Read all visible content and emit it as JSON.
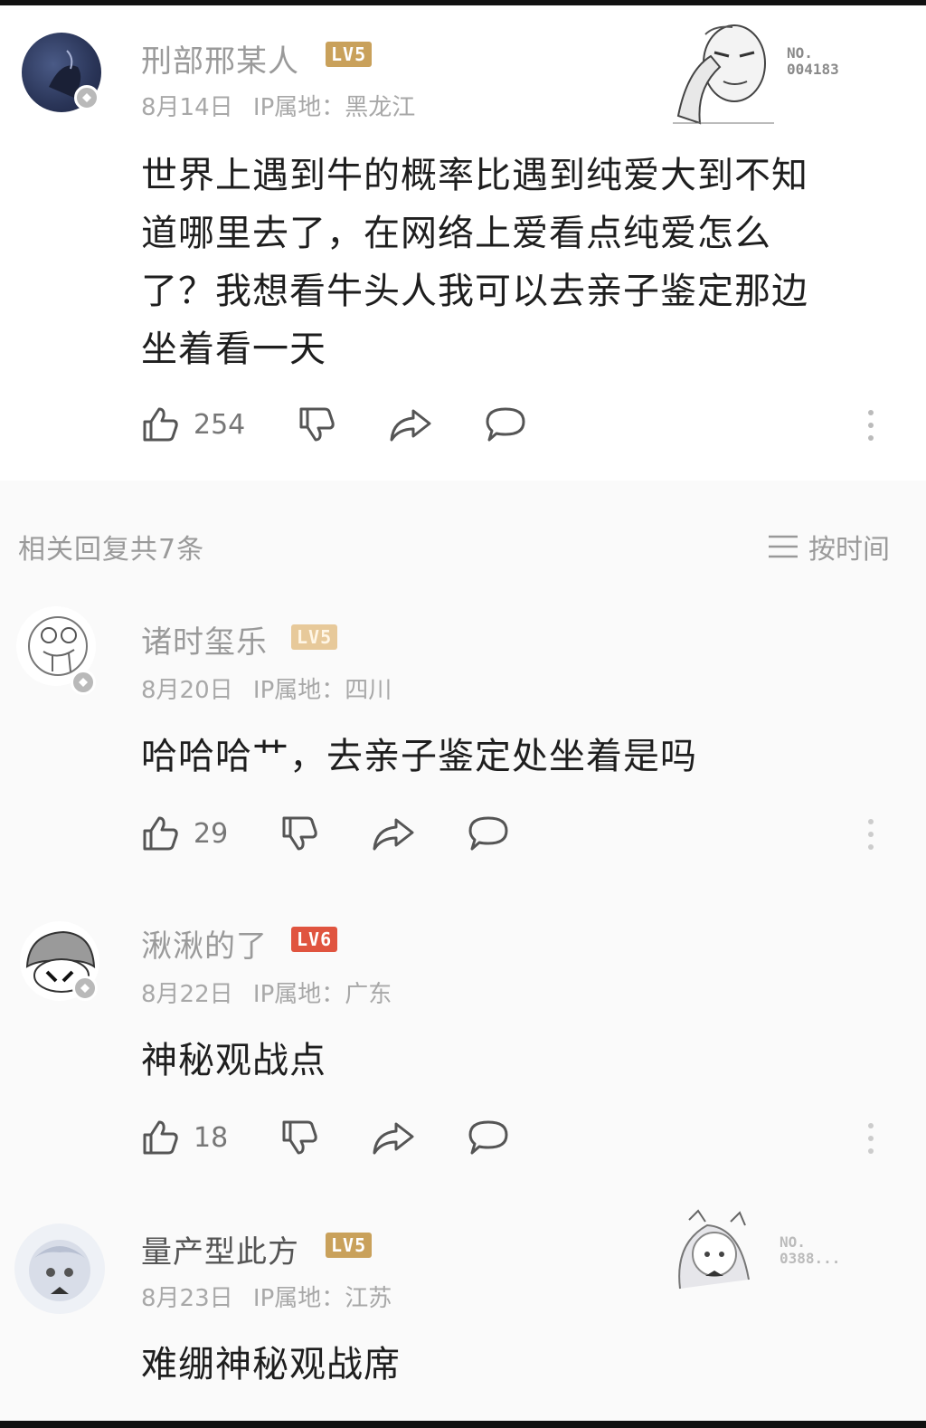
{
  "main_comment": {
    "username": "刑部邢某人",
    "level": "LV5",
    "date": "8月14日",
    "ip_location": "IP属地：黑龙江",
    "decor_no_label": "NO.",
    "decor_no_value": "004183",
    "text_lines": [
      "世界上遇到牛的概率比遇到纯爱大到不知",
      "道哪里去了，在网络上爱看点纯爱怎么",
      "了？我想看牛头人我可以去亲子鉴定那边",
      "坐着看一天"
    ],
    "like_count": "254"
  },
  "replies_header": {
    "count_label": "相关回复共7条",
    "sort_label": "按时间"
  },
  "replies": [
    {
      "username": "诸时玺乐",
      "level": "LV5",
      "date": "8月20日",
      "ip_location": "IP属地：四川",
      "text": "哈哈哈艹，去亲子鉴定处坐着是吗",
      "like_count": "29"
    },
    {
      "username": "湫湫的了",
      "level": "LV6",
      "date": "8月22日",
      "ip_location": "IP属地：广东",
      "text": "神秘观战点",
      "like_count": "18"
    },
    {
      "username": "量产型此方",
      "level": "LV5",
      "date": "8月23日",
      "ip_location": "IP属地：江苏",
      "text": "难绷神秘观战席",
      "decor_no_label": "NO.",
      "decor_no_value": "0388..."
    }
  ],
  "colors": {
    "level_badge": "#c9a15b",
    "level_badge_faded": "#e7c99a",
    "level_badge_lv6": "#e0543f",
    "muted_text": "#9a9a9a",
    "body_text": "#1e1e1e"
  },
  "icons": [
    "thumbs-up-icon",
    "thumbs-down-icon",
    "share-icon",
    "comment-icon",
    "more-icon",
    "sort-icon",
    "avatar-badge-icon"
  ]
}
